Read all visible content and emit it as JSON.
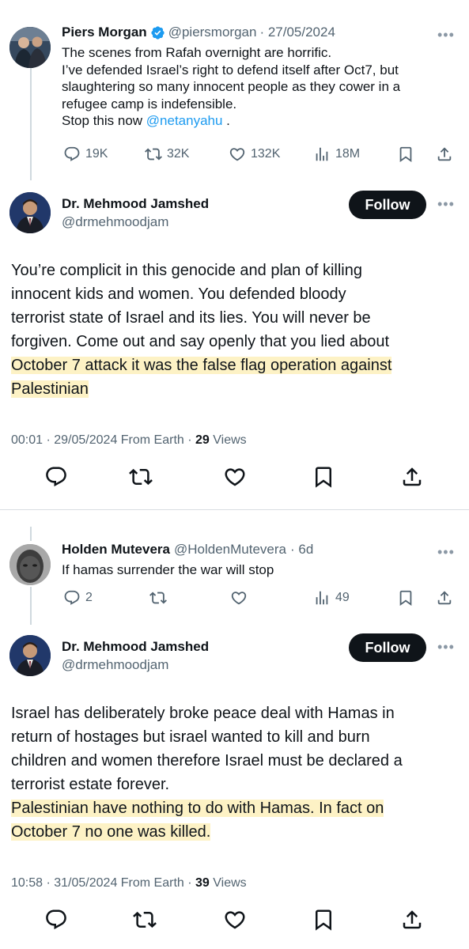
{
  "tweet1": {
    "name": "Piers Morgan",
    "handle": "@piersmorgan",
    "date": "· 27/05/2024",
    "lines": [
      "The scenes from Rafah overnight are horrific.",
      "I’ve defended Israel’s right to defend itself after Oct7, but",
      "slaughtering so many innocent people as they cower in a",
      "refugee camp is indefensible."
    ],
    "last_line_prefix": "Stop this now ",
    "mention": "@netanyahu",
    "last_line_suffix": " .",
    "replies": "19K",
    "retweets": "32K",
    "likes": "132K",
    "views": "18M"
  },
  "reply1": {
    "name": "Dr. Mehmood Jamshed",
    "handle": "@drmehmoodjam",
    "follow_label": "Follow",
    "lines": [
      "You’re complicit in this genocide and plan of killing",
      "innocent kids and women. You defended bloody",
      "terrorist state of Israel and its lies. You will never be",
      "forgiven. Come out and say openly that you lied about"
    ],
    "highlight_lines": [
      "October 7 attack it was the false flag operation against",
      "Palestinian"
    ],
    "time": "00:01 · 29/05/2024 From Earth · ",
    "views_count": "29",
    "views_label": " Views"
  },
  "tweet2": {
    "name": "Holden Mutevera",
    "handle": "@HoldenMutevera",
    "date": "· 6d",
    "text": "If hamas surrender the war will stop",
    "replies": "2",
    "views": "49"
  },
  "reply2": {
    "name": "Dr. Mehmood Jamshed",
    "handle": "@drmehmoodjam",
    "follow_label": "Follow",
    "lines": [
      "Israel has deliberately broke peace deal with Hamas in",
      "return of hostages but israel wanted to kill and burn",
      "children and women therefore Israel must be declared a",
      "terrorist estate forever."
    ],
    "highlight_lines": [
      "Palestinian have nothing to do with Hamas. In fact on",
      "October 7 no one was killed."
    ],
    "time": "10:58 · 31/05/2024 From Earth · ",
    "views_count": "39",
    "views_label": " Views"
  },
  "more_label": "•••",
  "colors": {
    "accent": "#1d9bf0",
    "verified": "#1d9bf0",
    "highlight": "#fdf2c5",
    "muted": "#536471"
  }
}
